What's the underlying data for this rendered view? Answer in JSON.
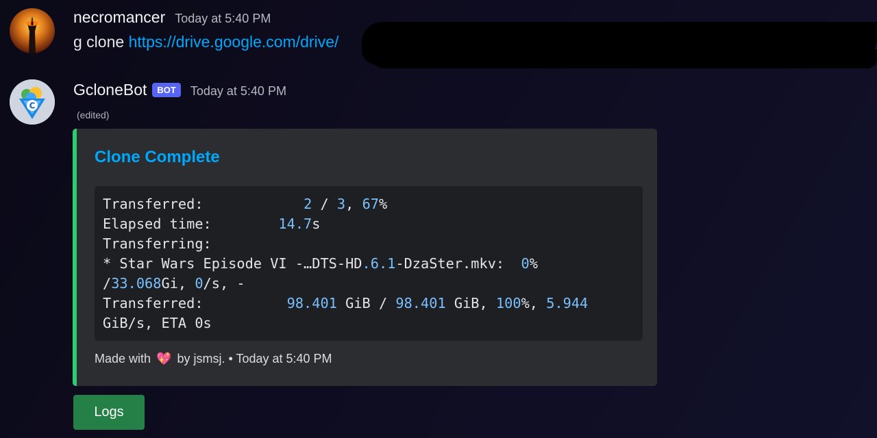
{
  "messages": [
    {
      "username": "necromancer",
      "timestamp": "Today at 5:40 PM",
      "command": "g clone ",
      "link": "https://drive.google.com/drive/"
    },
    {
      "username": "GcloneBot",
      "bot_tag": "BOT",
      "timestamp": "Today at 5:40 PM",
      "edited": "(edited)"
    }
  ],
  "embed": {
    "accent_color": "#2ecc71",
    "title": "Clone Complete",
    "code_lines": [
      [
        {
          "t": "Transferred:            ",
          "c": "txt"
        },
        {
          "t": "2",
          "c": "num"
        },
        {
          "t": " / ",
          "c": "txt"
        },
        {
          "t": "3",
          "c": "num"
        },
        {
          "t": ", ",
          "c": "txt"
        },
        {
          "t": "67",
          "c": "num"
        },
        {
          "t": "%",
          "c": "txt"
        }
      ],
      [
        {
          "t": "Elapsed time:        ",
          "c": "txt"
        },
        {
          "t": "14.7",
          "c": "num"
        },
        {
          "t": "s",
          "c": "txt"
        }
      ],
      [
        {
          "t": "Transferring:",
          "c": "txt"
        }
      ],
      [
        {
          "t": "* Star Wars Episode VI -…DTS-HD",
          "c": "txt"
        },
        {
          "t": ".6.1",
          "c": "num"
        },
        {
          "t": "-DzaSter.mkv:  ",
          "c": "txt"
        },
        {
          "t": "0",
          "c": "num"
        },
        {
          "t": "%",
          "c": "txt"
        }
      ],
      [
        {
          "t": "/",
          "c": "txt"
        },
        {
          "t": "33.068",
          "c": "num"
        },
        {
          "t": "Gi, ",
          "c": "txt"
        },
        {
          "t": "0",
          "c": "num"
        },
        {
          "t": "/s, -",
          "c": "txt"
        }
      ],
      [
        {
          "t": "Transferred:          ",
          "c": "txt"
        },
        {
          "t": "98.401",
          "c": "num"
        },
        {
          "t": " GiB / ",
          "c": "txt"
        },
        {
          "t": "98.401",
          "c": "num"
        },
        {
          "t": " GiB, ",
          "c": "txt"
        },
        {
          "t": "100",
          "c": "num"
        },
        {
          "t": "%, ",
          "c": "txt"
        },
        {
          "t": "5.944",
          "c": "num"
        }
      ],
      [
        {
          "t": "GiB/s, ETA 0s",
          "c": "txt"
        }
      ]
    ],
    "footer_prefix": "Made with",
    "footer_icon": "heart-icon",
    "footer_suffix": "by jsmsj. • Today at 5:40 PM"
  },
  "logs_button": "Logs"
}
